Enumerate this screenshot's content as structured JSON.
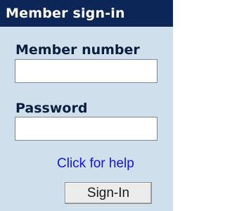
{
  "header": {
    "title": "Member sign-in"
  },
  "form": {
    "member_number_label": "Member number",
    "member_number_value": "",
    "password_label": "Password",
    "password_value": "",
    "help_link": "Click for help",
    "signin_button": "Sign-In"
  },
  "colors": {
    "panel_background": "#cfdfec",
    "header_background": "#0c2757",
    "header_text": "#ffffff",
    "label_text": "#0b1f3d",
    "link": "#1515e0",
    "button_background": "#ececec"
  }
}
